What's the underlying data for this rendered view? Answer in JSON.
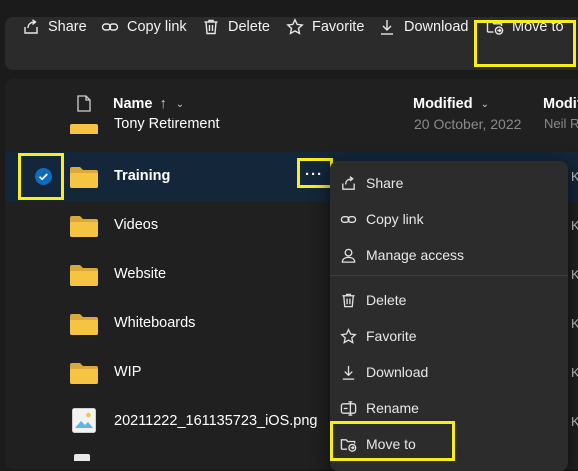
{
  "toolbar": {
    "share": "Share",
    "copy_link": "Copy link",
    "delete": "Delete",
    "favorite": "Favorite",
    "download": "Download",
    "move_to": "Move to"
  },
  "columns": {
    "name": "Name",
    "name_sort": "↑",
    "modified": "Modified",
    "modified_by": "Modifi"
  },
  "partial_row": {
    "name": "Tony Retirement",
    "modified": "20 October, 2022",
    "modified_by": "Neil R"
  },
  "rows": [
    {
      "name": "Training",
      "type": "folder",
      "selected": true,
      "modified_by_initial": "K"
    },
    {
      "name": "Videos",
      "type": "folder",
      "modified_by_initial": "K"
    },
    {
      "name": "Website",
      "type": "folder",
      "modified_by_initial": "K"
    },
    {
      "name": "Whiteboards",
      "type": "folder",
      "modified_by_initial": "K"
    },
    {
      "name": "WIP",
      "type": "folder",
      "modified_by_initial": "K"
    },
    {
      "name": "20211222_161135723_iOS.png",
      "type": "image",
      "modified_by_initial": "K"
    }
  ],
  "more_actions_glyph": "···",
  "context_menu": {
    "share": "Share",
    "copy_link": "Copy link",
    "manage_access": "Manage access",
    "delete": "Delete",
    "favorite": "Favorite",
    "download": "Download",
    "rename": "Rename",
    "move_to": "Move to"
  },
  "colors": {
    "accent": "#0f6cbd",
    "folder": "#f6c443",
    "highlight": "#f6ef1c",
    "selected_row": "#14263a"
  }
}
